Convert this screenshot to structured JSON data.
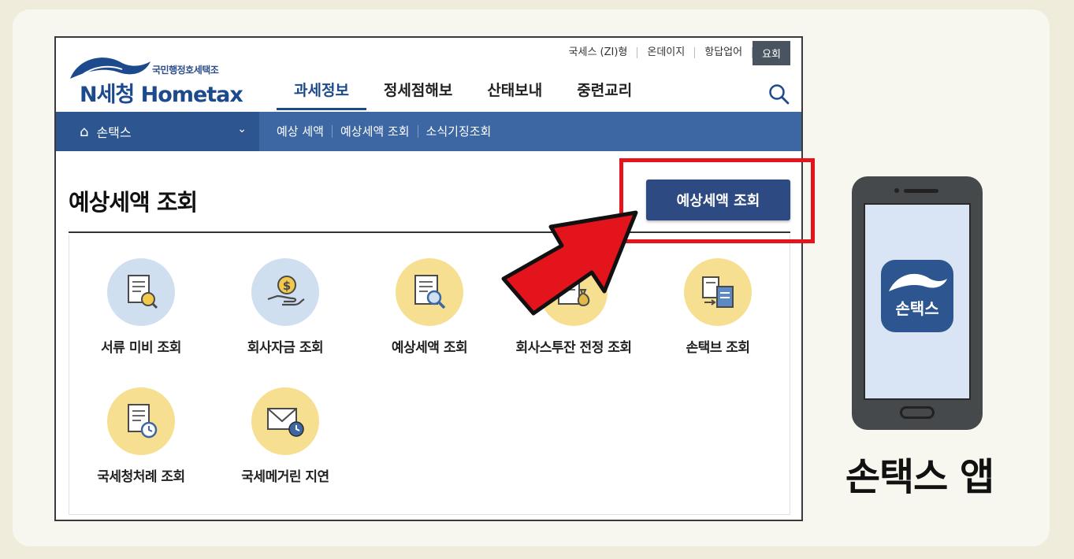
{
  "header": {
    "logo_sub": "국민행정호세택조",
    "logo_main": "N세청 Hometax",
    "util_links": [
      "국세스 (ZI)형",
      "온데이지",
      "항답업어"
    ],
    "util_button": "요회",
    "gnb": [
      "과세정보",
      "정세점해보",
      "산태보내",
      "중련교리"
    ],
    "gnb_active": "과세정보"
  },
  "subnav": {
    "home_label": "손택스",
    "links": [
      "예상 세액",
      "예상세액 조회",
      "소식기징조회"
    ]
  },
  "page": {
    "title": "예상세액 조회",
    "main_button": "예상세액 조회"
  },
  "services": [
    {
      "label": "서류 미비 조회",
      "icon": "document-search-icon",
      "color": "blue"
    },
    {
      "label": "회사자금 조회",
      "icon": "coin-hand-icon",
      "color": "blue"
    },
    {
      "label": "예상세액 조회",
      "icon": "document-magnifier-icon",
      "color": "yellow"
    },
    {
      "label": "회사스투잔 전정 조회",
      "icon": "money-bag-document-icon",
      "color": "yellow"
    },
    {
      "label": "손택브 조회",
      "icon": "document-transfer-icon",
      "color": "yellow"
    },
    {
      "label": "국세청처례 조회",
      "icon": "document-clock-icon",
      "color": "yellow"
    },
    {
      "label": "국세메거린 지연",
      "icon": "envelope-clock-icon",
      "color": "yellow"
    }
  ],
  "phone": {
    "app_label": "손택스",
    "caption": "손택스 앱"
  },
  "colors": {
    "brand_blue": "#2d4a82",
    "subnav_blue": "#3c67a3",
    "highlight_red": "#e3141b"
  }
}
